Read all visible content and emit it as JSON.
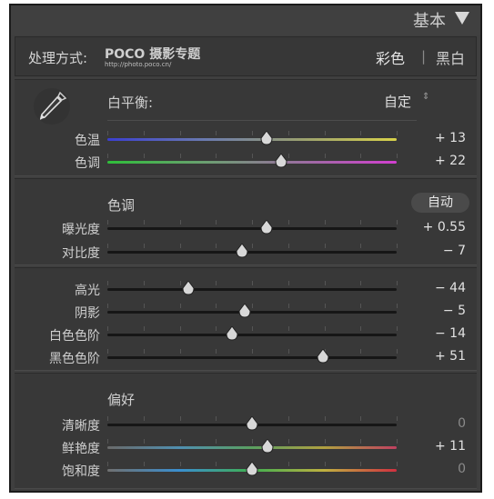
{
  "header": {
    "title": "基本"
  },
  "treatment": {
    "label": "处理方式:",
    "logo_main": "POCO 摄影专题",
    "logo_url": "http://photo.poco.cn/",
    "color": "彩色",
    "separator": "|",
    "bw": "黑白"
  },
  "white_balance": {
    "label": "白平衡:",
    "value": "自定",
    "updown": "⇕",
    "sliders": [
      {
        "label": "色温",
        "value": "+ 13",
        "level": 0.55,
        "track": "temp"
      },
      {
        "label": "色调",
        "value": "+ 22",
        "level": 0.6,
        "track": "tint"
      }
    ]
  },
  "tone": {
    "title": "色调",
    "auto": "自动",
    "sliders": [
      {
        "label": "曝光度",
        "value": "+ 0.55",
        "level": 0.55,
        "track": "gray"
      },
      {
        "label": "对比度",
        "value": "− 7",
        "level": 0.465,
        "track": "gray"
      }
    ]
  },
  "light": {
    "sliders": [
      {
        "label": "高光",
        "value": "− 44",
        "level": 0.28,
        "track": "gray"
      },
      {
        "label": "阴影",
        "value": "− 5",
        "level": 0.475,
        "track": "gray"
      },
      {
        "label": "白色色阶",
        "value": "− 14",
        "level": 0.43,
        "track": "gray"
      },
      {
        "label": "黑色色阶",
        "value": "+ 51",
        "level": 0.745,
        "track": "gray"
      }
    ]
  },
  "presence": {
    "title": "偏好",
    "sliders": [
      {
        "label": "清晰度",
        "value": "0",
        "level": 0.5,
        "track": "gray",
        "zero": true
      },
      {
        "label": "鲜艳度",
        "value": "+ 11",
        "level": 0.555,
        "track": "vibrance"
      },
      {
        "label": "饱和度",
        "value": "0",
        "level": 0.5,
        "track": "saturation",
        "zero": true
      }
    ]
  },
  "colors": {
    "panel": "#3f3f3f",
    "section": "#383838",
    "text": "#cfcfcf"
  }
}
